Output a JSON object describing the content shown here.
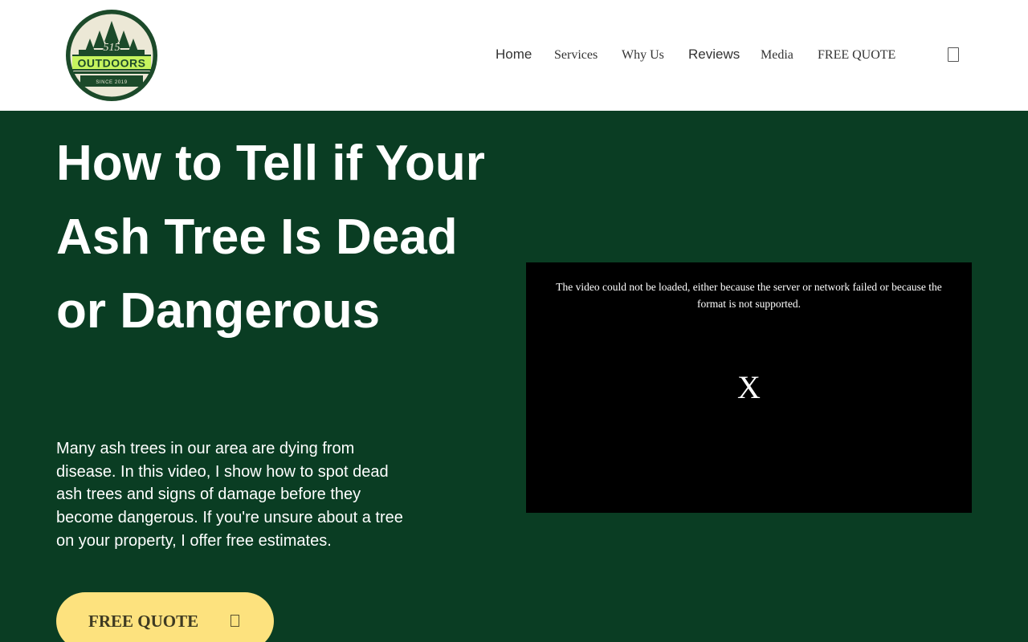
{
  "header": {
    "logo": {
      "brand_number": "515",
      "brand_name": "OUTDOORS",
      "since": "SINCE 2019",
      "colors": {
        "ring": "#1c4a2a",
        "inner": "#ece8d6",
        "band": "#c6f45e",
        "trees": "#1c4a2a"
      }
    },
    "nav": {
      "items": [
        {
          "label": "Home"
        },
        {
          "label": "Services"
        },
        {
          "label": "Why Us"
        },
        {
          "label": "Reviews"
        },
        {
          "label": "Media"
        },
        {
          "label": "FREE QUOTE"
        }
      ],
      "extra_icon": "cart-icon"
    }
  },
  "hero": {
    "title": "How to Tell if Your Ash Tree Is Dead or Dangerous",
    "description": "Many ash trees in our area are dying from disease. In this video, I show how to spot dead ash trees and signs of damage before they become dangerous. If you're unsure about a tree on your property, I offer free estimates.",
    "cta": {
      "label": "FREE QUOTE",
      "icon": "arrow-icon"
    }
  },
  "video": {
    "error_message": "The video could not be loaded, either because the server or network failed or because the format is not supported.",
    "close_glyph": "X"
  },
  "colors": {
    "hero_background": "#0a3d23",
    "header_background": "#ffffff",
    "cta_background": "#fde27e",
    "cta_text": "#3e3a22",
    "video_background": "#000000"
  }
}
